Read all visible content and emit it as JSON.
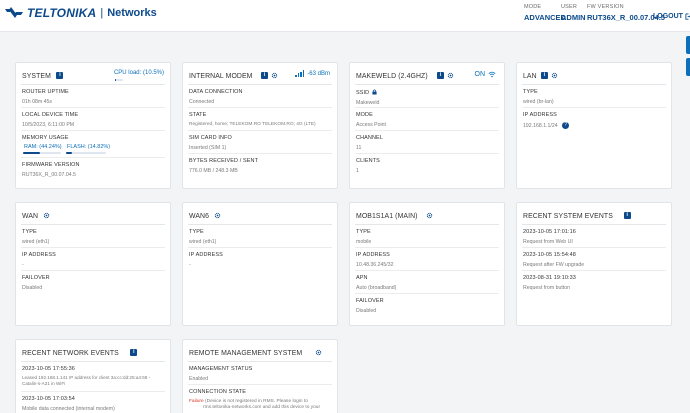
{
  "header": {
    "brand": "TELTONIKA",
    "brand_sub": "Networks",
    "mode_label": "MODE",
    "mode_value": "ADVANCED",
    "user_label": "USER",
    "user_value": "ADMIN",
    "fw_label": "FW VERSION",
    "fw_value": "RUT36X_R_00.07.04.5",
    "logout_label": "LOGOUT"
  },
  "system": {
    "title": "SYSTEM",
    "cpu_load": "CPU load: (10.5%)",
    "cpu_fraction": 0.105,
    "fields": [
      {
        "label": "ROUTER UPTIME",
        "value": "01h 08m 45s"
      },
      {
        "label": "LOCAL DEVICE TIME",
        "value": "10/5/2023, 6:11:00 PM"
      },
      {
        "label": "MEMORY USAGE",
        "value": ""
      },
      {
        "label": "FIRMWARE VERSION",
        "value": "RUT36X_R_00.07.04.5"
      }
    ],
    "ram_label": "RAM: (44.24%)",
    "ram_fraction": 0.4424,
    "flash_label": "FLASH: (14.82%)",
    "flash_fraction": 0.1482
  },
  "modem": {
    "title": "INTERNAL MODEM",
    "signal": "-63 dBm",
    "fields": [
      {
        "label": "DATA CONNECTION",
        "value": "Connected"
      },
      {
        "label": "STATE",
        "value": "Registered, home; TELEKOM.RO TELEKOM.RO; 4G (LTE)"
      },
      {
        "label": "SIM CARD INFO",
        "value": "Inserted (SIM 1)"
      },
      {
        "label": "BYTES RECEIVED / SENT",
        "value": "776.0 MB / 248.3 MB"
      }
    ]
  },
  "wifi": {
    "title": "MAKEWELD (2.4GHZ)",
    "status": "ON",
    "fields": [
      {
        "label": "SSID",
        "value": "Makeweld"
      },
      {
        "label": "MODE",
        "value": "Access Point"
      },
      {
        "label": "CHANNEL",
        "value": "11"
      },
      {
        "label": "CLIENTS",
        "value": "1"
      }
    ]
  },
  "lan": {
    "title": "LAN",
    "fields": [
      {
        "label": "TYPE",
        "value": "wired (br-lan)"
      },
      {
        "label": "IP ADDRESS",
        "value": "192.168.1.1/24"
      }
    ]
  },
  "wan": {
    "title": "WAN",
    "fields": [
      {
        "label": "TYPE",
        "value": "wired (eth1)"
      },
      {
        "label": "IP ADDRESS",
        "value": "-"
      },
      {
        "label": "FAILOVER",
        "value": "Disabled"
      }
    ]
  },
  "wan6": {
    "title": "WAN6",
    "fields": [
      {
        "label": "TYPE",
        "value": "wired (eth1)"
      },
      {
        "label": "IP ADDRESS",
        "value": "-"
      }
    ]
  },
  "mob": {
    "title": "MOB1S1A1 (MAIN)",
    "fields": [
      {
        "label": "TYPE",
        "value": "mobile"
      },
      {
        "label": "IP ADDRESS",
        "value": "10.48.36.245/32"
      },
      {
        "label": "APN",
        "value": "Auto (broadband)"
      },
      {
        "label": "FAILOVER",
        "value": "Disabled"
      }
    ]
  },
  "sys_events": {
    "title": "RECENT SYSTEM EVENTS",
    "items": [
      {
        "time": "2023-10-05 17:01:16",
        "text": "Request from Web UI"
      },
      {
        "time": "2023-10-05 15:54:48",
        "text": "Request after FW upgrade"
      },
      {
        "time": "2023-08-31 19:10:33",
        "text": "Request from button"
      }
    ]
  },
  "net_events": {
    "title": "RECENT NETWORK EVENTS",
    "items": [
      {
        "time": "2023-10-05 17:55:36",
        "text": "Leased 192.168.1.141 IP address for client 3a:cc:dd:25:a4:58 -",
        "text2": "Catalin-s-A21 in WiFi"
      },
      {
        "time": "2023-10-05 17:03:54",
        "text": "Mobile data connected (internal modem)",
        "text2": ""
      }
    ]
  },
  "rms": {
    "title": "REMOTE MANAGEMENT SYSTEM",
    "fields": [
      {
        "label": "MANAGEMENT STATUS",
        "value": "Enabled"
      },
      {
        "label": "CONNECTION STATE",
        "value": ""
      }
    ],
    "state_failure": "Failure",
    "state_text": " (Device is not registered in RMS. Please login to",
    "state_text2": "rms.teltonika-networks.com and add this device to your"
  },
  "colors": {
    "brand": "#0c4a8c",
    "accent": "#0c6fb8",
    "failure": "#d9352b"
  },
  "icons": [
    "teltonika-logo-icon",
    "info-icon",
    "gear-icon",
    "signal-icon",
    "wifi-icon",
    "lock-icon",
    "help-icon",
    "logout-icon"
  ]
}
